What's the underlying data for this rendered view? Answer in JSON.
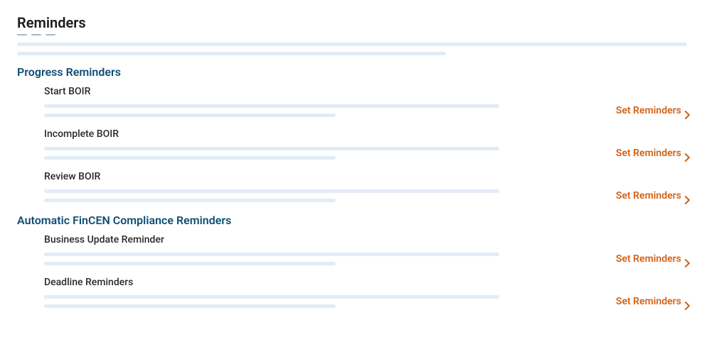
{
  "page_title": "Reminders",
  "action_label": "Set Reminders",
  "colors": {
    "accent": "#d26214",
    "section_heading": "#0e4f74",
    "skeleton": "#e2ecf5"
  },
  "sections": [
    {
      "heading": "Progress Reminders",
      "items": [
        {
          "title": "Start BOIR"
        },
        {
          "title": "Incomplete BOIR"
        },
        {
          "title": "Review BOIR"
        }
      ]
    },
    {
      "heading": "Automatic FinCEN Compliance Reminders",
      "items": [
        {
          "title": "Business Update Reminder"
        },
        {
          "title": "Deadline Reminders"
        }
      ]
    }
  ]
}
